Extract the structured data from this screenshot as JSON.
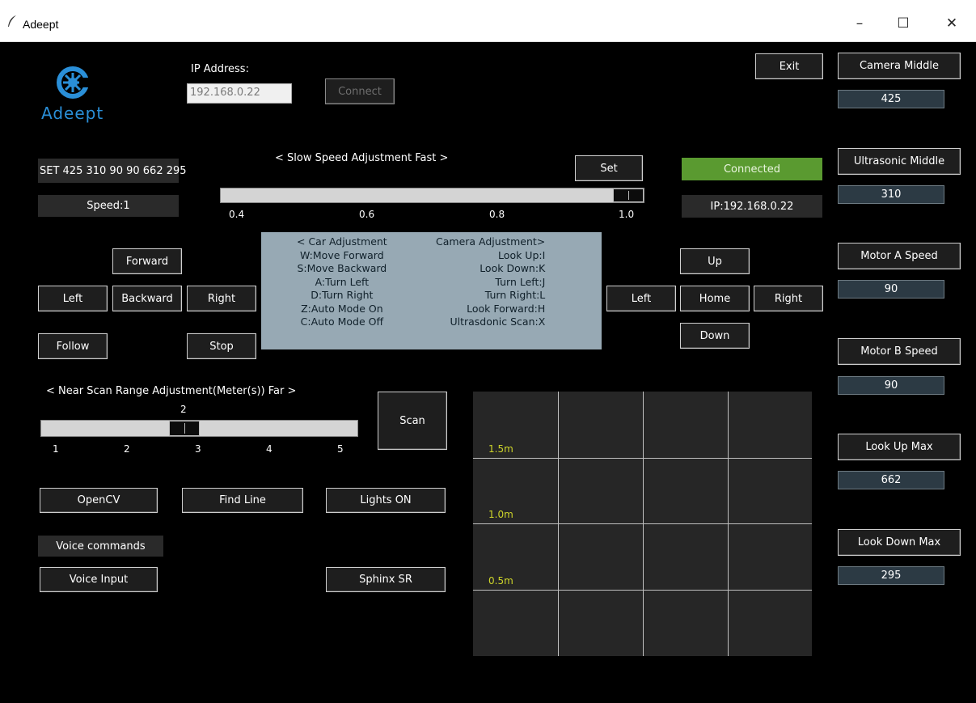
{
  "window": {
    "title": "Adeept",
    "min_glyph": "–",
    "max_glyph": "☐",
    "close_glyph": "✕"
  },
  "logo": {
    "text": "Adeept"
  },
  "ip": {
    "label": "IP Address:",
    "value": "192.168.0.22",
    "connect_label": "Connect",
    "exit_label": "Exit"
  },
  "status": {
    "set_command": "SET 425 310 90 90 662 295",
    "speed": "Speed:1",
    "connection": "Connected",
    "ip_display": "IP:192.168.0.22"
  },
  "speed_slider": {
    "title": "< Slow   Speed Adjustment   Fast >",
    "set_label": "Set",
    "ticks": [
      "0.4",
      "0.6",
      "0.8",
      "1.0"
    ],
    "value": 1.0,
    "min": 0.4,
    "max": 1.0
  },
  "car_controls": {
    "forward": "Forward",
    "left": "Left",
    "backward": "Backward",
    "right": "Right",
    "follow": "Follow",
    "stop": "Stop"
  },
  "help_panel": {
    "car_title": "< Car Adjustment",
    "car_lines": [
      "W:Move Forward",
      "S:Move Backward",
      "A:Turn Left",
      "D:Turn Right",
      "Z:Auto Mode On",
      "C:Auto Mode Off"
    ],
    "camera_title": "Camera Adjustment>",
    "camera_lines": [
      "Look Up:I",
      "Look Down:K",
      "Turn Left:J",
      "Turn Right:L",
      "Look Forward:H",
      "Ultrasdonic Scan:X"
    ]
  },
  "camera_controls": {
    "up": "Up",
    "left": "Left",
    "home": "Home",
    "right": "Right",
    "down": "Down"
  },
  "scan": {
    "title": "< Near   Scan Range Adjustment(Meter(s))   Far >",
    "value_label": "2",
    "value": 2,
    "min": 1,
    "max": 5,
    "ticks": [
      "1",
      "2",
      "3",
      "4",
      "5"
    ],
    "scan_label": "Scan"
  },
  "features": {
    "opencv": "OpenCV",
    "find_line": "Find Line",
    "lights": "Lights ON",
    "voice_commands": "Voice commands",
    "voice_input": "Voice Input",
    "sphinx": "Sphinx SR"
  },
  "radar": {
    "labels": [
      "1.5m",
      "1.0m",
      "0.5m"
    ]
  },
  "servo_panel": [
    {
      "button": "Camera Middle",
      "value": "425"
    },
    {
      "button": "Ultrasonic Middle",
      "value": "310"
    },
    {
      "button": "Motor A Speed",
      "value": "90"
    },
    {
      "button": "Motor B Speed",
      "value": "90"
    },
    {
      "button": "Look Up Max",
      "value": "662"
    },
    {
      "button": "Look Down Max",
      "value": "295"
    }
  ],
  "colors": {
    "background": "#000000",
    "button_bg": "#1e1e1e",
    "connected_green": "#5a9a30",
    "help_panel_bg": "#97a9b4",
    "value_box_bg": "#2c3a44",
    "radar_bg": "#262626",
    "radar_label": "#cdd42a"
  }
}
